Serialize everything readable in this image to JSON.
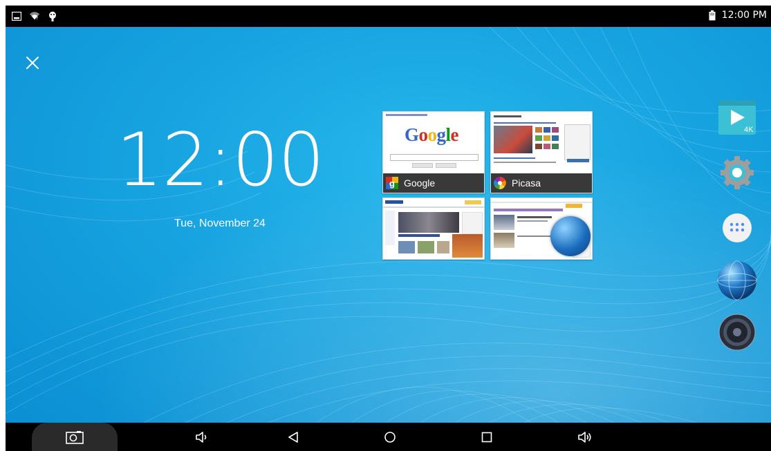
{
  "status_bar": {
    "time": "12:00 PM",
    "left_icons": [
      "gallery-notification-icon",
      "wifi-icon",
      "android-debug-icon"
    ],
    "right_icons": [
      "battery-icon"
    ]
  },
  "lock": {
    "time": "12:00",
    "date": "Tue, November 24"
  },
  "recents": {
    "cards": [
      {
        "label": "Google",
        "icon": "google-app-icon"
      },
      {
        "label": "Picasa",
        "icon": "picasa-app-icon"
      },
      {
        "label": "",
        "icon": ""
      },
      {
        "label": "",
        "icon": ""
      }
    ],
    "google_page": {
      "logo": "Google"
    }
  },
  "side_dock": {
    "items": [
      "video-4k-icon",
      "settings-icon",
      "app-drawer-icon",
      "browser-globe-icon",
      "speaker-icon"
    ],
    "badge_4k": "4K"
  },
  "nav_bar": {
    "items": [
      "screenshot-icon",
      "volume-down-icon",
      "back-icon",
      "home-icon",
      "recents-icon",
      "volume-up-icon"
    ]
  },
  "colors": {
    "wallpaper": "#17a3e0",
    "bar": "#000000",
    "dock_teal": "#3cc0d6"
  }
}
